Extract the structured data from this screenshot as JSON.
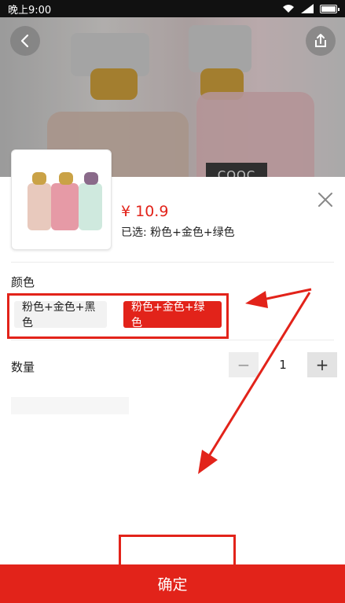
{
  "status_bar": {
    "time": "晚上9:00"
  },
  "product": {
    "bottle_label": "COOC",
    "price": "¥ 10.9",
    "selected_text": "已选: 粉色+金色+绿色"
  },
  "color_section": {
    "label": "颜色",
    "options": [
      "粉色+金色+黑色",
      "粉色+金色+绿色"
    ],
    "selected_index": 1
  },
  "quantity_section": {
    "label": "数量",
    "minus": "−",
    "value": "1",
    "plus": "+"
  },
  "confirm_button": {
    "label": "确定"
  },
  "colors": {
    "accent": "#e2231a",
    "annotation": "#e2231a"
  },
  "icons": [
    "back-icon",
    "share-icon",
    "close-icon",
    "wifi-icon",
    "signal-icon",
    "battery-icon"
  ]
}
